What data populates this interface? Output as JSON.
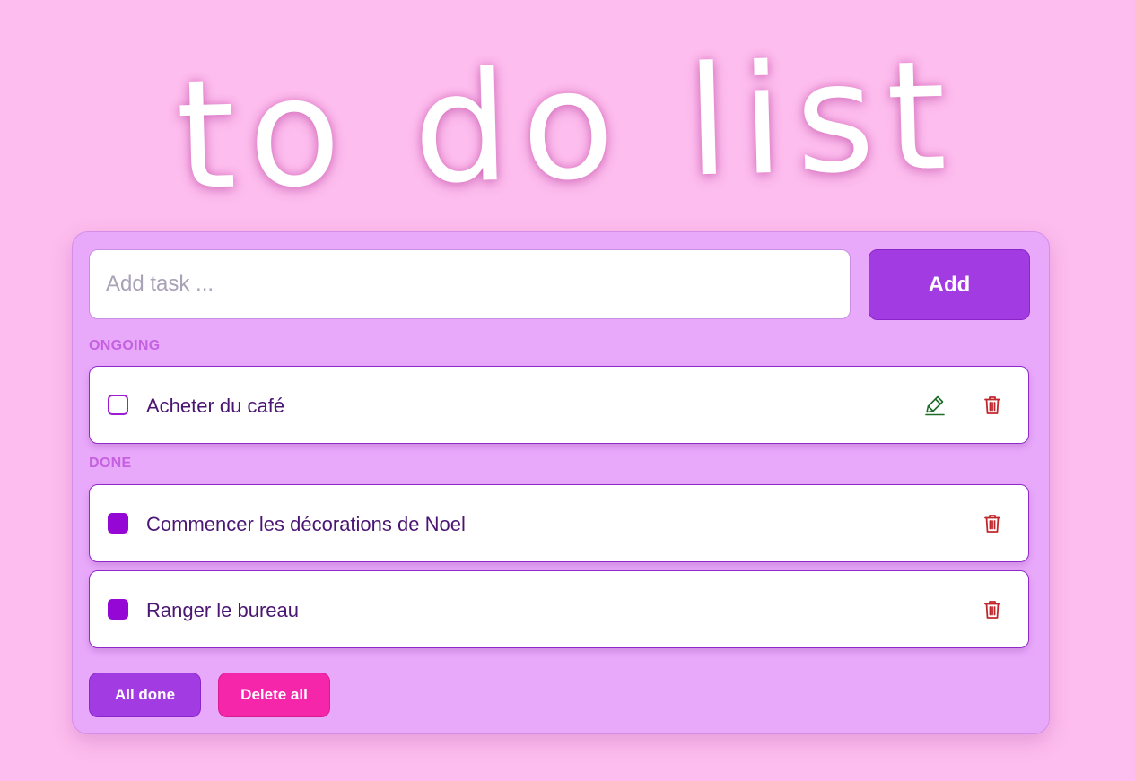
{
  "app": {
    "title": "to do list"
  },
  "input": {
    "placeholder": "Add task ...",
    "value": ""
  },
  "buttons": {
    "add_label": "Add",
    "all_done_label": "All done",
    "delete_all_label": "Delete all"
  },
  "sections": {
    "ongoing_label": "ONGOING",
    "done_label": "DONE"
  },
  "tasks": {
    "ongoing": [
      {
        "text": "Acheter du café",
        "done": false,
        "icons": [
          "edit-pencil-icon",
          "trash-icon"
        ]
      }
    ],
    "done": [
      {
        "text": "Commencer les décorations de Noel",
        "done": true,
        "icons": [
          "trash-icon"
        ]
      },
      {
        "text": "Ranger le bureau",
        "done": true,
        "icons": [
          "trash-icon"
        ]
      }
    ]
  },
  "colors": {
    "page_background": "#fdbdee",
    "card_background": "#e9a9fb",
    "primary_purple": "#a33be2",
    "checked_purple": "#9407d4",
    "pink_danger": "#f526aa",
    "edit_icon_green": "#1e6b2a",
    "delete_icon_red": "#c0272d",
    "section_label": "#c561e0"
  }
}
